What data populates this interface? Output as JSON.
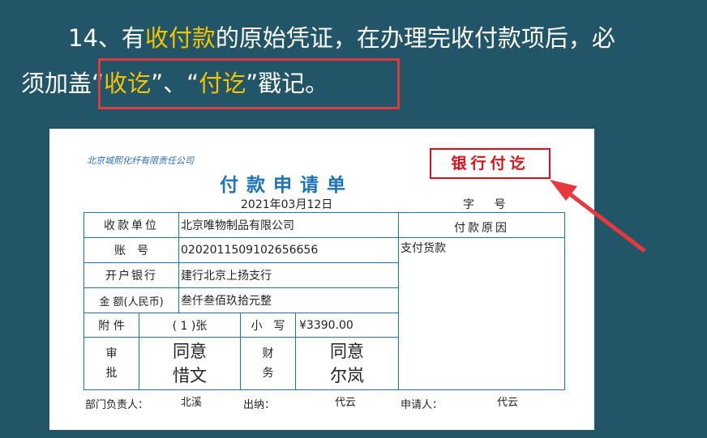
{
  "heading": {
    "l1_a": "14、有",
    "l1_hl": "收付款",
    "l1_b": "的原始凭证，在办理完收付款项后，必",
    "l2_a": "须加盖",
    "l2_q1o": "“",
    "l2_hl1": "收讫",
    "l2_q1c": "”、“",
    "l2_hl2": "付讫",
    "l2_b": "”戳记。"
  },
  "form": {
    "company": "北京城熙化纤有限责任公司",
    "title": "付款申请单",
    "date": "2021年03月12日",
    "zihao": "字 号",
    "stamp": "银行付讫",
    "payee_label": "收款单位",
    "payee": "北京唯物制品有限公司",
    "account_label": "账　号",
    "account": "0202011509102656656",
    "bank_label": "开户银行",
    "bank": "建行北京上扬支行",
    "amount_label": "金 额(人民币)",
    "amount_words": "叁仟叁佰玖拾元整",
    "attach_label": "附 件",
    "attach": "( 1 )张",
    "small_label": "小　写",
    "small": "¥3390.00",
    "approve_label": "审\n批",
    "approve": "同意\n惜文",
    "finance_label": "财\n务",
    "finance": "同意\n尔岚",
    "reason_label": "付款原因",
    "reason": "支付货款",
    "dept_label": "部门负责人：",
    "dept": "北溪",
    "cashier_label": "出纳：",
    "cashier": "代云",
    "applicant_label": "申请人：",
    "applicant": "代云"
  }
}
